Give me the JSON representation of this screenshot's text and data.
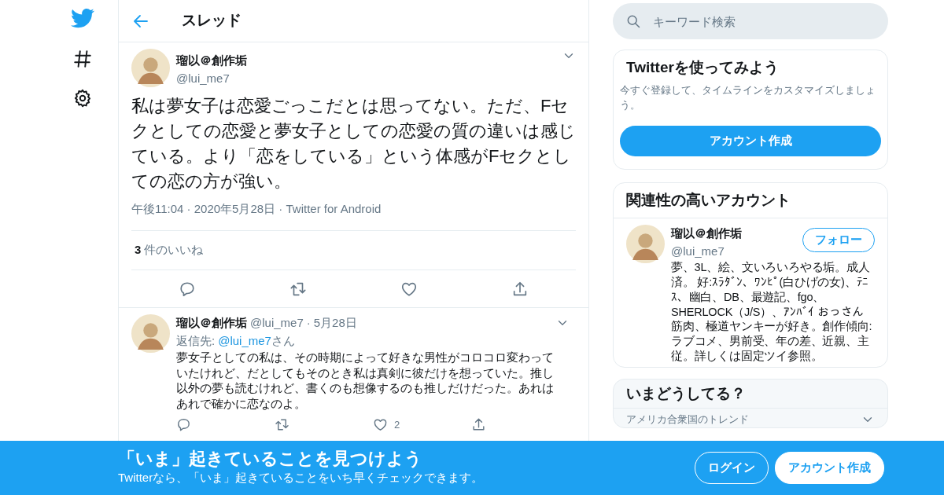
{
  "header": {
    "title": "スレッド"
  },
  "main_tweet": {
    "name": "瑠以＠創作垢",
    "handle": "@lui_me7",
    "text": "私は夢女子は恋愛ごっこだとは思ってない。ただ、Fセクとしての恋愛と夢女子としての恋愛の質の違いは感じている。より「恋をしている」という体感がFセクとしての恋の方が強い。",
    "meta": "午後11:04 · 2020年5月28日 · Twitter for Android",
    "likes_count": "3",
    "likes_label": "件のいいね"
  },
  "reply": {
    "name": "瑠以＠創作垢",
    "handle": "@lui_me7",
    "separator": "·",
    "date": "5月28日",
    "reply_label": "返信先:",
    "mention": "@lui_me7",
    "mention_suffix": "さん",
    "text": "夢女子としての私は、その時期によって好きな男性がコロコロ変わっていたけれど、だとしてもそのとき私は真剣に彼だけを想っていた。推し以外の夢も読むけれど、書くのも想像するのも推しだけだった。あれはあれで確かに恋なのよ。",
    "like_count": "2"
  },
  "search": {
    "placeholder": "キーワード検索"
  },
  "signup_card": {
    "title": "Twitterを使ってみよう",
    "description": "今すぐ登録して、タイムラインをカスタマイズしましょう。",
    "button": "アカウント作成"
  },
  "related": {
    "title": "関連性の高いアカウント",
    "accounts": [
      {
        "name": "瑠以＠創作垢",
        "handle": "@lui_me7",
        "button": "フォロー",
        "bio": "夢、3L、絵、文いろいろやる垢。成人済。 好:ｽﾗﾀﾞﾝ、ﾜﾝﾋﾟ(白ひげの女)、ﾃﾆｽ、幽白、DB、最遊記、fgo、SHERLOCK（J/S）、ｱﾝﾊﾞｲ おっさん筋肉、極道ヤンキーが好き。創作傾向:ラブコメ、男前受、年の差、近親、主従。詳しくは固定ツイ参照。"
      }
    ]
  },
  "trends": {
    "title": "いまどうしてる？",
    "items": [
      {
        "context": "アメリカ合衆国のトレンド"
      }
    ]
  },
  "banner": {
    "title": "「いま」起きていることを見つけよう",
    "subtitle": "Twitterなら、「いま」起きていることをいち早くチェックできます。",
    "buttons": [
      {
        "label": "ログイン",
        "kind": "outline"
      },
      {
        "label": "アカウント作成",
        "kind": "solid"
      }
    ]
  }
}
